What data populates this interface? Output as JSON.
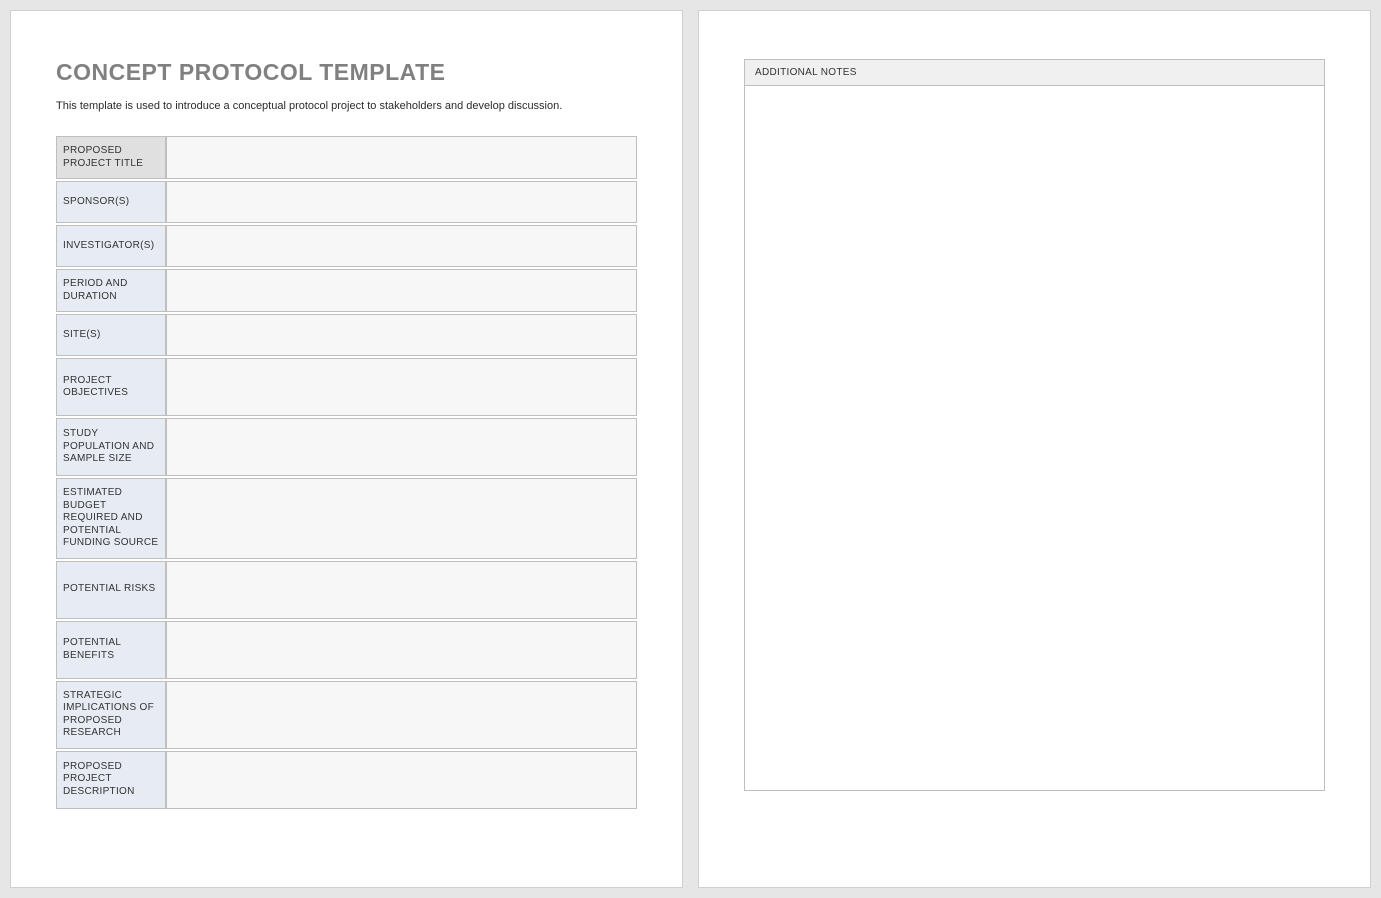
{
  "doc": {
    "title": "CONCEPT PROTOCOL TEMPLATE",
    "subtitle": "This template is used to introduce a conceptual protocol project to stakeholders and develop discussion."
  },
  "fields": [
    {
      "label": "PROPOSED PROJECT TITLE",
      "value": ""
    },
    {
      "label": "SPONSOR(S)",
      "value": ""
    },
    {
      "label": "INVESTIGATOR(S)",
      "value": ""
    },
    {
      "label": "PERIOD AND DURATION",
      "value": ""
    },
    {
      "label": "SITE(S)",
      "value": ""
    },
    {
      "label": "PROJECT OBJECTIVES",
      "value": ""
    },
    {
      "label": "STUDY POPULATION AND SAMPLE SIZE",
      "value": ""
    },
    {
      "label": "ESTIMATED BUDGET REQUIRED AND POTENTIAL FUNDING SOURCE",
      "value": ""
    },
    {
      "label": "POTENTIAL RISKS",
      "value": ""
    },
    {
      "label": "POTENTIAL BENEFITS",
      "value": ""
    },
    {
      "label": "STRATEGIC IMPLICATIONS OF PROPOSED RESEARCH",
      "value": ""
    },
    {
      "label": "PROPOSED PROJECT DESCRIPTION",
      "value": ""
    }
  ],
  "notes": {
    "header": "ADDITIONAL NOTES",
    "body": ""
  }
}
